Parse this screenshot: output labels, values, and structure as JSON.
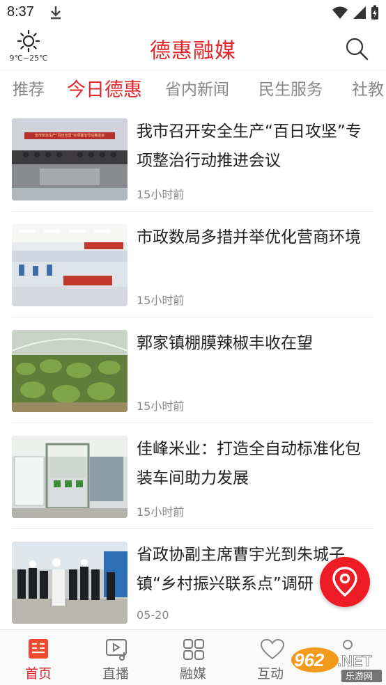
{
  "status_bar": {
    "time": "8:37"
  },
  "header": {
    "weather": {
      "icon": "sun-icon",
      "temp_range": "9℃~25℃"
    },
    "title": "德惠融媒"
  },
  "tabs": [
    {
      "label": "推荐",
      "active": false
    },
    {
      "label": "今日德惠",
      "active": true
    },
    {
      "label": "省内新闻",
      "active": false
    },
    {
      "label": "民生服务",
      "active": false
    },
    {
      "label": "社教",
      "active": false
    }
  ],
  "news": [
    {
      "title": "我市召开安全生产“百日攻坚”专项整治行动推进会议",
      "time": "15小时前",
      "thumb_banner": "全市安全生产“百日攻坚”专项整治行动推进会"
    },
    {
      "title": "市政数局多措并举优化营商环境",
      "time": "15小时前"
    },
    {
      "title": "郭家镇棚膜辣椒丰收在望",
      "time": "15小时前"
    },
    {
      "title": "佳峰米业：打造全自动标准化包装车间助力发展",
      "time": "15小时前"
    },
    {
      "title": "省政协副主席曹宇光到朱城子镇“乡村振兴联系点”调研",
      "time": "05-20"
    }
  ],
  "bottom_nav": [
    {
      "label": "首页",
      "icon": "home-news-icon",
      "active": true
    },
    {
      "label": "直播",
      "icon": "live-video-icon",
      "active": false
    },
    {
      "label": "融媒",
      "icon": "grid-icon",
      "active": false
    },
    {
      "label": "互动",
      "icon": "heart-icon",
      "active": false
    }
  ],
  "colors": {
    "accent": "#e0262b",
    "fab": "#ee1c25"
  },
  "watermark": {
    "text_top": "962.NET",
    "text_bottom": "乐游网"
  }
}
